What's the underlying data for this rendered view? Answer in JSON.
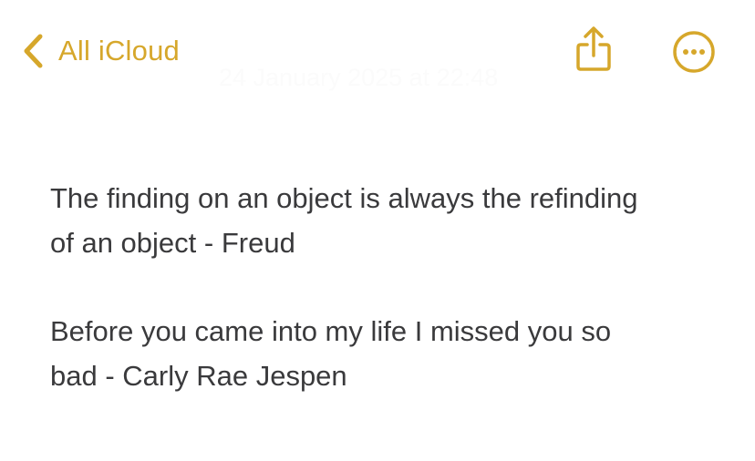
{
  "nav": {
    "back_label": "All iCloud",
    "back_icon": "chevron-left-icon",
    "share_icon": "share-icon",
    "more_icon": "ellipsis-circle-icon"
  },
  "note": {
    "timestamp": "24 January 2025 at 22:48",
    "paragraphs": [
      {
        "lines": [
          "The finding on an object is always the refinding",
          "of an object - Freud"
        ]
      },
      {
        "lines": [
          "Before you came into my life I missed you so",
          "bad - Carly Rae Jespen"
        ]
      }
    ]
  },
  "colors": {
    "accent": "#d6a72b",
    "text": "#3a3a3c",
    "background": "#ffffff"
  }
}
